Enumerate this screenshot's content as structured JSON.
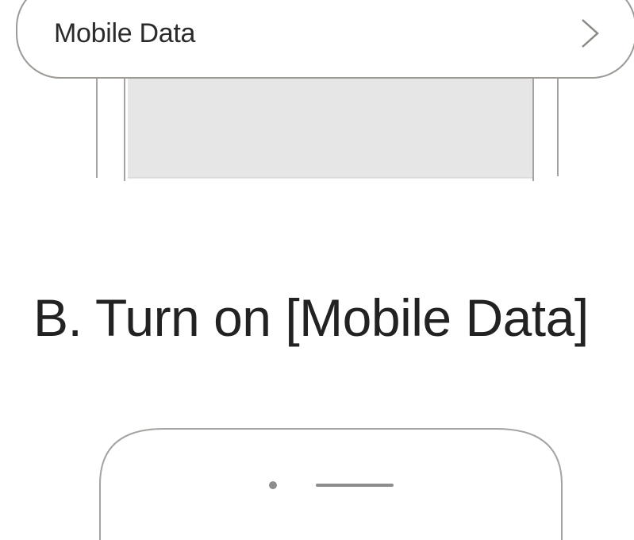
{
  "callout": {
    "label": "Mobile Data",
    "chevron_icon": "chevron-right-icon"
  },
  "heading": {
    "text": "B. Turn on [Mobile Data]"
  },
  "colors": {
    "outline": "#9d9994",
    "screen_fill": "#e6e6e6",
    "text": "#222222"
  }
}
